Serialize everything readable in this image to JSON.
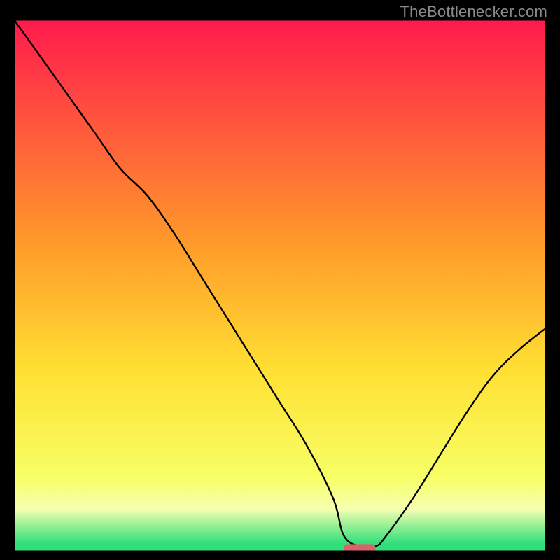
{
  "watermark": "TheBottlenecker.com",
  "colors": {
    "frame": "#000000",
    "curve": "#000000",
    "marker": "#d9626b",
    "gradient_top": "#ff1a4d",
    "gradient_mid_upper": "#ff9a2a",
    "gradient_mid": "#ffe033",
    "gradient_mid_lower": "#f7ff66",
    "gradient_band": "#f6ffb0",
    "gradient_bottom": "#2fe07a"
  },
  "chart_data": {
    "type": "line",
    "title": "",
    "xlabel": "",
    "ylabel": "",
    "xlim": [
      0,
      100
    ],
    "ylim": [
      0,
      100
    ],
    "series": [
      {
        "name": "bottleneck-curve",
        "x": [
          0,
          5,
          10,
          15,
          20,
          25,
          30,
          35,
          40,
          45,
          50,
          55,
          60,
          62,
          65,
          68,
          70,
          75,
          80,
          85,
          90,
          95,
          100
        ],
        "y": [
          100,
          93,
          86,
          79,
          72,
          67,
          60,
          52,
          44,
          36,
          28,
          20,
          10,
          3,
          1,
          1,
          3,
          10,
          18,
          26,
          33,
          38,
          42
        ]
      }
    ],
    "marker": {
      "x_start": 62,
      "x_end": 68,
      "y": 0.6
    },
    "gradient_bands": [
      {
        "y": 100,
        "color": "#ff1a4d"
      },
      {
        "y": 60,
        "color": "#ff9a2a"
      },
      {
        "y": 35,
        "color": "#ffe033"
      },
      {
        "y": 12,
        "color": "#f7ff66"
      },
      {
        "y": 6,
        "color": "#f6ffb0"
      },
      {
        "y": 1,
        "color": "#2fe07a"
      }
    ]
  }
}
